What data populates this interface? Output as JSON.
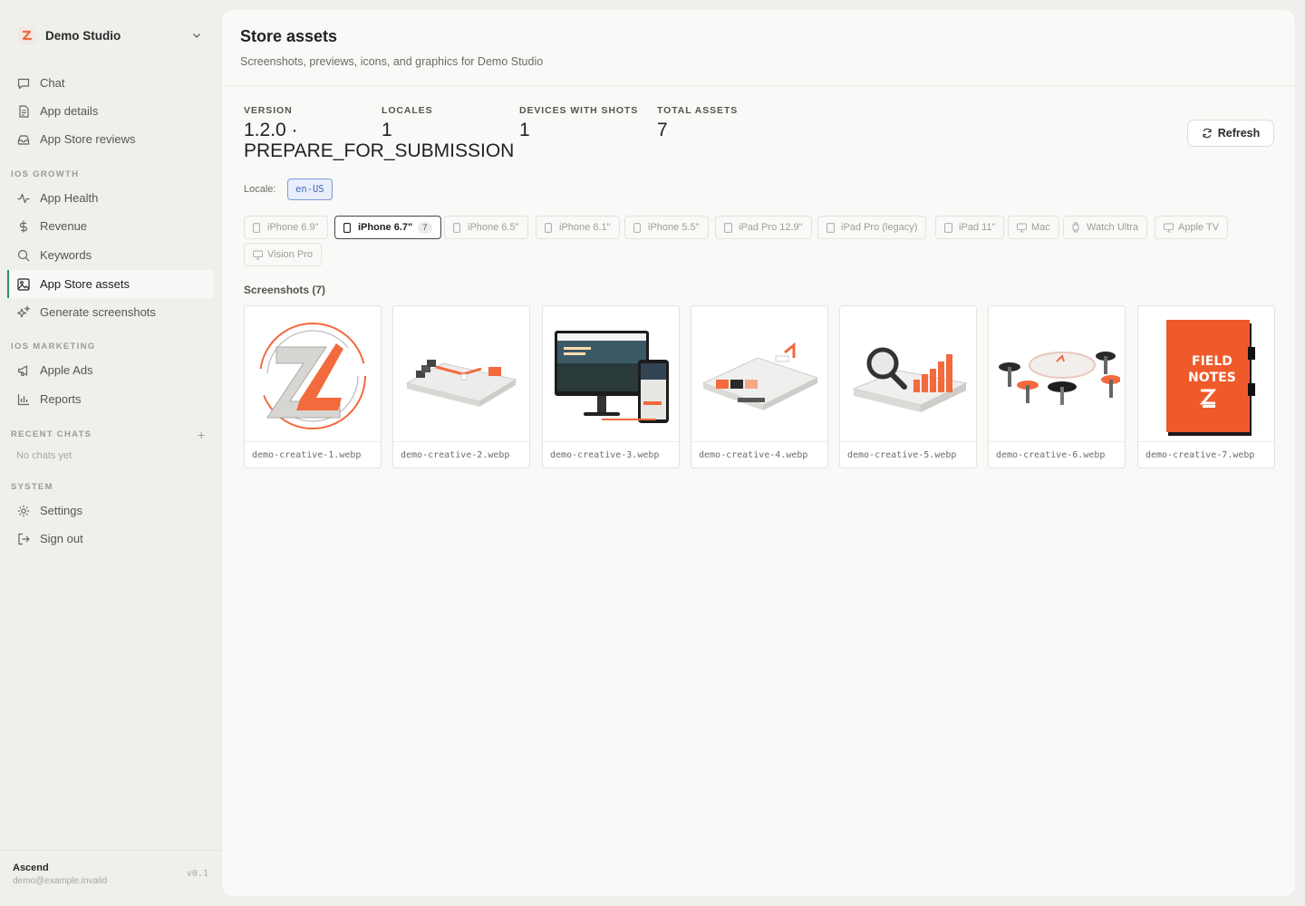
{
  "workspace": {
    "name": "Demo Studio"
  },
  "nav": {
    "top": [
      {
        "label": "Chat",
        "icon": "chat-icon"
      },
      {
        "label": "App details",
        "icon": "document-icon"
      },
      {
        "label": "App Store reviews",
        "icon": "inbox-icon"
      }
    ],
    "ios_growth_label": "IOS GROWTH",
    "ios_growth": [
      {
        "label": "App Health",
        "icon": "activity-icon"
      },
      {
        "label": "Revenue",
        "icon": "dollar-icon"
      },
      {
        "label": "Keywords",
        "icon": "search-icon"
      },
      {
        "label": "App Store assets",
        "icon": "image-icon",
        "active": true
      },
      {
        "label": "Generate screenshots",
        "icon": "sparkles-icon"
      }
    ],
    "ios_marketing_label": "IOS MARKETING",
    "ios_marketing": [
      {
        "label": "Apple Ads",
        "icon": "megaphone-icon"
      },
      {
        "label": "Reports",
        "icon": "bar-chart-icon"
      }
    ],
    "recent_chats_label": "RECENT CHATS",
    "no_chats": "No chats yet",
    "system_label": "SYSTEM",
    "system": [
      {
        "label": "Settings",
        "icon": "gear-icon"
      },
      {
        "label": "Sign out",
        "icon": "sign-out-icon"
      }
    ]
  },
  "footer": {
    "name": "Ascend",
    "email": "demo@example.invalid",
    "version": "v0.1"
  },
  "page": {
    "title": "Store assets",
    "subtitle": "Screenshots, previews, icons, and graphics for Demo Studio"
  },
  "stats": [
    {
      "label": "VERSION",
      "value": "1.2.0 · PREPARE_FOR_SUBMISSION"
    },
    {
      "label": "LOCALES",
      "value": "1"
    },
    {
      "label": "DEVICES WITH SHOTS",
      "value": "1"
    },
    {
      "label": "TOTAL ASSETS",
      "value": "7"
    }
  ],
  "refresh_label": "Refresh",
  "locale": {
    "label": "Locale:",
    "value": "en-US"
  },
  "devices": [
    {
      "label": "iPhone 6.9\"",
      "icon": "phone-icon"
    },
    {
      "label": "iPhone 6.7\"",
      "icon": "phone-icon",
      "active": true,
      "count": "7"
    },
    {
      "label": "iPhone 6.5\"",
      "icon": "phone-icon"
    },
    {
      "label": "iPhone 6.1\"",
      "icon": "phone-icon"
    },
    {
      "label": "iPhone 5.5\"",
      "icon": "phone-icon"
    },
    {
      "label": "iPad Pro 12.9\"",
      "icon": "tablet-icon"
    },
    {
      "label": "iPad Pro (legacy)",
      "icon": "tablet-icon"
    },
    {
      "label": "iPad 11\"",
      "icon": "tablet-icon"
    },
    {
      "label": "Mac",
      "icon": "monitor-icon"
    },
    {
      "label": "Watch Ultra",
      "icon": "watch-icon"
    },
    {
      "label": "Apple TV",
      "icon": "monitor-icon"
    },
    {
      "label": "Vision Pro",
      "icon": "monitor-icon"
    }
  ],
  "screenshots_title": "Screenshots (7)",
  "screenshots": [
    {
      "file": "demo-creative-1.webp"
    },
    {
      "file": "demo-creative-2.webp"
    },
    {
      "file": "demo-creative-3.webp"
    },
    {
      "file": "demo-creative-4.webp"
    },
    {
      "file": "demo-creative-5.webp"
    },
    {
      "file": "demo-creative-6.webp"
    },
    {
      "file": "demo-creative-7.webp"
    }
  ],
  "notebook_cover": {
    "line1": "FIELD",
    "line2": "NOTES"
  },
  "colors": {
    "accent": "#f26a3d",
    "active_bar": "#2e8b6e",
    "locale_chip": "#4568b8"
  }
}
